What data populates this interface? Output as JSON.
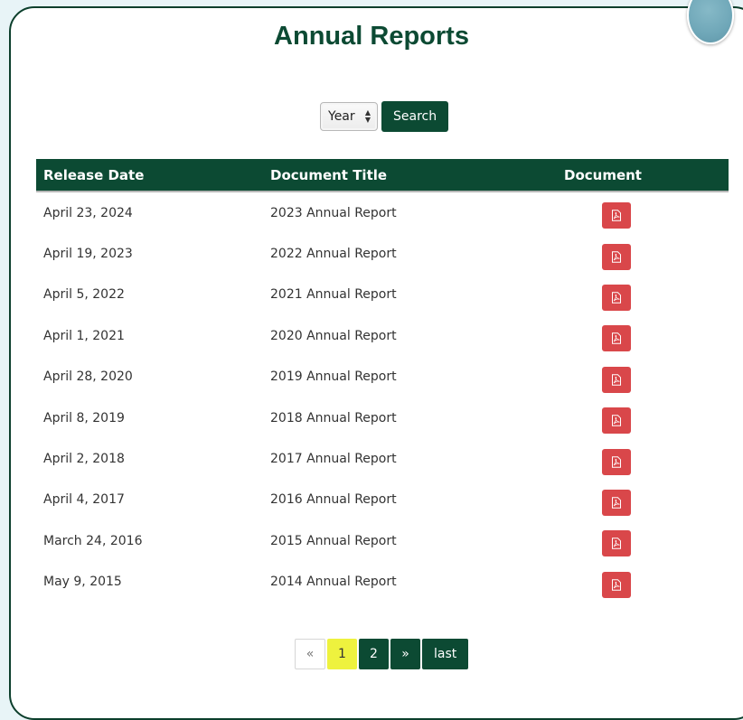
{
  "page": {
    "title": "Annual Reports"
  },
  "filter": {
    "year_select_value": "Year",
    "search_label": "Search"
  },
  "table": {
    "headers": [
      "Release Date",
      "Document Title",
      "Document"
    ],
    "rows": [
      {
        "date": "April 23, 2024",
        "title": "2023 Annual Report"
      },
      {
        "date": "April 19, 2023",
        "title": "2022 Annual Report"
      },
      {
        "date": "April 5, 2022",
        "title": "2021 Annual Report"
      },
      {
        "date": "April 1, 2021",
        "title": "2020 Annual Report"
      },
      {
        "date": "April 28, 2020",
        "title": "2019 Annual Report"
      },
      {
        "date": "April 8, 2019",
        "title": "2018 Annual Report"
      },
      {
        "date": "April 2, 2018",
        "title": "2017 Annual Report"
      },
      {
        "date": "April 4, 2017",
        "title": "2016 Annual Report"
      },
      {
        "date": "March 24, 2016",
        "title": "2015 Annual Report"
      },
      {
        "date": "May 9, 2015",
        "title": "2014 Annual Report"
      }
    ],
    "document_icon": "pdf-file-icon"
  },
  "pagination": {
    "prev_label": "«",
    "pages": [
      "1",
      "2"
    ],
    "current_page": "1",
    "next_label": "»",
    "last_label": "last"
  },
  "colors": {
    "brand_green": "#0c4a33",
    "pdf_red": "#d9474a",
    "current_page_highlight": "#eef23e"
  }
}
